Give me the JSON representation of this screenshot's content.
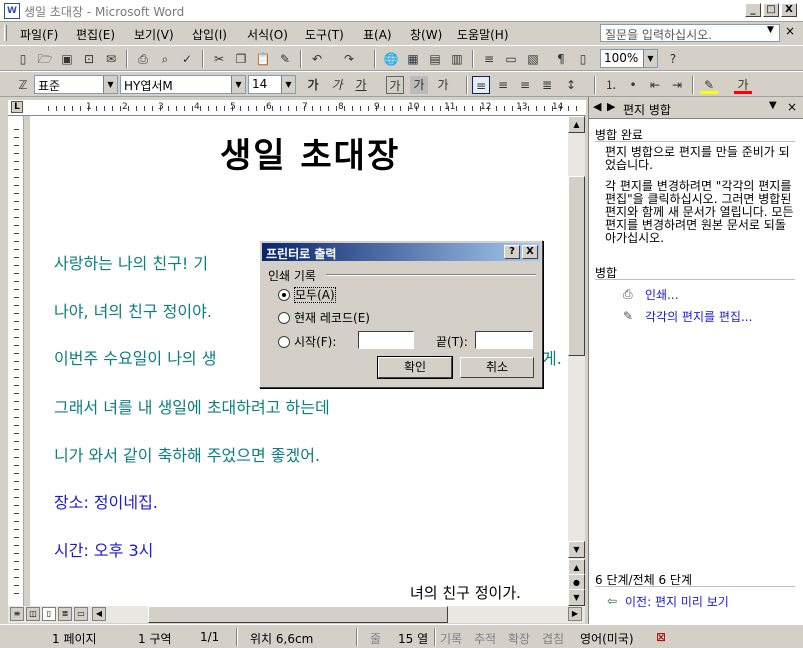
{
  "window": {
    "title": "생일 초대장 - Microsoft Word",
    "app_icon": "W",
    "controls": {
      "minimize": "_",
      "maximize": "□",
      "close": "X"
    }
  },
  "menu": {
    "items": [
      "파일(F)",
      "편집(E)",
      "보기(V)",
      "삽입(I)",
      "서식(O)",
      "도구(T)",
      "표(A)",
      "창(W)",
      "도움말(H)"
    ],
    "help_placeholder": "질문을 입력하십시오.",
    "doc_close": "×"
  },
  "toolbar": {
    "zoom": "100%",
    "style": "표준",
    "font": "HY엽서M",
    "size": "14",
    "bold_label": "가",
    "italic_label": "가",
    "underline_label": "가",
    "border_label": "가",
    "shade_label": "가",
    "scale_label": "가"
  },
  "ruler": {
    "corner": "L",
    "numbers": [
      "1",
      "2",
      "3",
      "4",
      "5",
      "6",
      "7",
      "8",
      "9",
      "10",
      "11",
      "12",
      "13",
      "14"
    ]
  },
  "document": {
    "title": "생일 초대장",
    "lines": [
      "사랑하는 나의 친구! 기",
      "나야, 녀의 친구 정이야.",
      "이번주 수요일이 나의 생",
      "그래서 녀를 내 생일에 초대하려고 하는데",
      "니가 와서 같이 축하해 주었으면 좋겠어.",
      "장소: 정이네집.",
      "시간: 오후 3시"
    ],
    "line_overflow": "게.",
    "signature": "녀의 친구 정이가."
  },
  "dialog": {
    "title": "프린터로 출력",
    "help_btn": "?",
    "close_btn": "X",
    "group_label": "인쇄 기록",
    "options": [
      "모두(A)",
      "현재 레코드(E)",
      "시작(F):"
    ],
    "selected_index": 0,
    "to_label": "끝(T):",
    "ok": "확인",
    "cancel": "취소"
  },
  "task_pane": {
    "title": "편지 병합",
    "section1": "병합 완료",
    "text1": "편지 병합으로 편지를 만들 준비가 되었습니다.",
    "text2": "각 편지를 변경하려면 \"각각의 편지를 편집\"을 클릭하십시오. 그러면 병합된 편지와 함께 새 문서가 열립니다. 모든 편지를 변경하려면 원본 문서로 되돌아가십시오.",
    "section2": "병합",
    "link_print": "인쇄...",
    "link_edit": "각각의 편지를 편집...",
    "step": "6 단계/전체  6 단계",
    "prev_link": "이전: 편지 미리 보기"
  },
  "status": {
    "page": "1 페이지",
    "section": "1 구역",
    "pages": "1/1",
    "position": "위치 6,6cm",
    "line": "줄",
    "col": "15 열",
    "rec": "기록",
    "trk": "추적",
    "ext": "확장",
    "ovr": "겹침",
    "lang": "영어(미국)"
  }
}
